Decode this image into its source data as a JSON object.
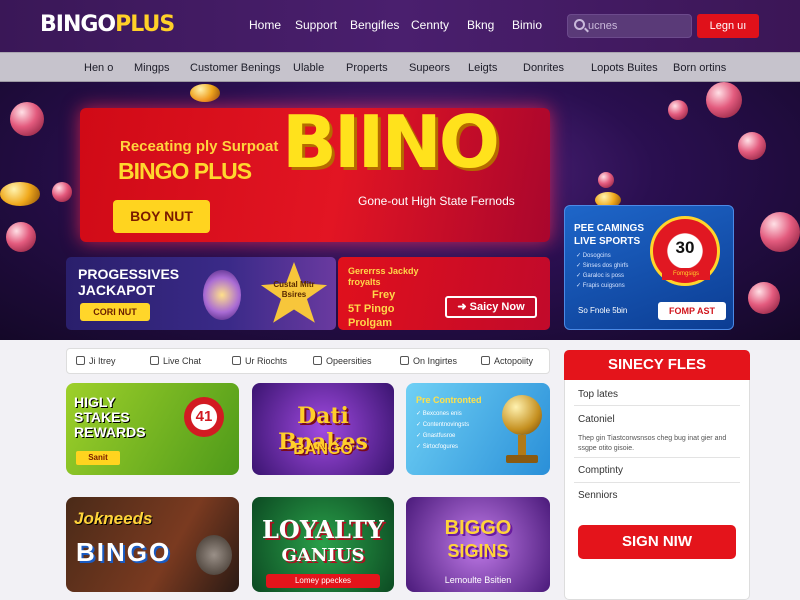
{
  "header": {
    "logo_a": "BINGO",
    "logo_b": "PLUS",
    "nav": [
      "Home",
      "Support",
      "Bengifies",
      "Cennty",
      "Bkng",
      "Bimio"
    ],
    "search_placeholder": "ucnes",
    "login": "Legn uı"
  },
  "subnav": [
    "Hen o",
    "Mingps",
    "Customer Benings",
    "Ulable",
    "Properts",
    "Supeors",
    "Leigts",
    "Donrites",
    "Lopots Buites",
    "Born ortins"
  ],
  "hero": {
    "subtitle": "Receating ply Surpoat",
    "brand": "BINGO PLUS",
    "big": "BIINO",
    "tagline": "Gone-out High State Fernods",
    "button": "BOY NUT"
  },
  "jackpot": {
    "line1": "PROGESSIVES",
    "line2": "JACKAPOT",
    "button": "CORI NUT",
    "badge": "Custal Mitr Bsires"
  },
  "gen_promo": {
    "line1": "Gererrss Jackdy froyalts",
    "line2": "Frey",
    "line3": "5T Pingo",
    "line4": "Prolgam",
    "button": "Saicy Now"
  },
  "side_promo": {
    "title_a": "PEE CAMINGS",
    "title_b": "LIVE SPORTS",
    "items": [
      "Dosogcins",
      "Sinses dos ghirfs",
      "Garaloc is poss",
      "Frapis cuigsons"
    ],
    "footer": "So Fnole 5bin",
    "button": "FOMP AST",
    "wheel_number": "30",
    "wheel_label": "Fomgsigs"
  },
  "quickbar": [
    "Ji Itrey",
    "Live Chat",
    "Ur Riochts",
    "Opeersities",
    "On Ingirtes",
    "Actopoiity"
  ],
  "cards": [
    {
      "title": "HIGLY STAKES REWARDS",
      "extra": "41",
      "button": "Sanit"
    },
    {
      "title": "Dati Bpakes",
      "sub": "BANGO"
    },
    {
      "title": "Pre Contronted",
      "lines": [
        "Bexcones enis",
        "Contentnovingsts",
        "Gnastfusroe",
        "Sirtocfogures"
      ]
    },
    {
      "title": "Jokneeds",
      "sub": "BINGO"
    },
    {
      "title": "LOYALTY",
      "sub": "GANIUS",
      "button": "Lomey ppeckes"
    },
    {
      "title": "BIGGO",
      "sub": "SIGINS",
      "footer": "Lemoulte Bsitien"
    }
  ],
  "sidebar": {
    "header": "SINECY FLES",
    "items": [
      "Top lates",
      "Catoniel",
      "Comptinty",
      "Senniors"
    ],
    "desc": "Thep gin Tiastcorwsnsos cheg bug inat gier and ssgpe otito gisoie.",
    "button": "SIGN NIW"
  },
  "colors": {
    "accent_red": "#e4141b",
    "gold": "#ffd41f",
    "purple": "#3a1757"
  }
}
